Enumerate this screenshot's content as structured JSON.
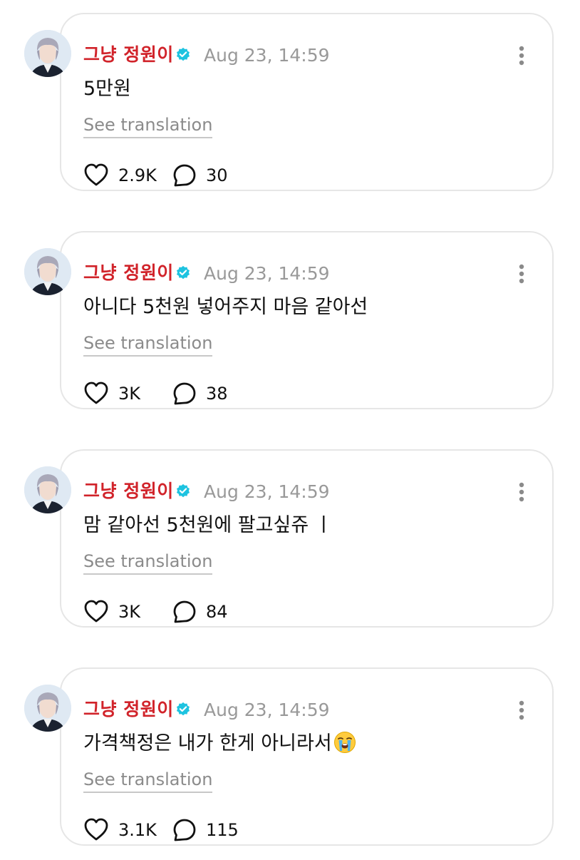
{
  "posts": [
    {
      "author": "그냥 정원이",
      "timestamp": "Aug 23, 14:59",
      "content": "5만원",
      "translate_label": "See translation",
      "likes": "2.9K",
      "replies": "30"
    },
    {
      "author": "그냥 정원이",
      "timestamp": "Aug 23, 14:59",
      "content": "아니다 5천원 넣어주지 마음 같아선",
      "translate_label": "See translation",
      "likes": "3K",
      "replies": "38"
    },
    {
      "author": "그냥 정원이",
      "timestamp": "Aug 23, 14:59",
      "content": "맘 같아선 5천원에 팔고싶쥬 ㅣ",
      "translate_label": "See translation",
      "likes": "3K",
      "replies": "84"
    },
    {
      "author": "그냥 정원이",
      "timestamp": "Aug 23, 14:59",
      "content": "가격책정은 내가 한게 아니라서",
      "content_emoji": "loudly-crying-face-emoji",
      "translate_label": "See translation",
      "likes": "3.1K",
      "replies": "115"
    }
  ],
  "colors": {
    "author": "#d1232a",
    "verified_badge": "#1ec3e0",
    "muted_text": "#999999",
    "card_border": "#e6e6e6"
  },
  "icons": {
    "verified": "verified-badge-icon",
    "more": "more-vertical-icon",
    "like": "heart-icon",
    "reply": "speech-bubble-icon"
  }
}
